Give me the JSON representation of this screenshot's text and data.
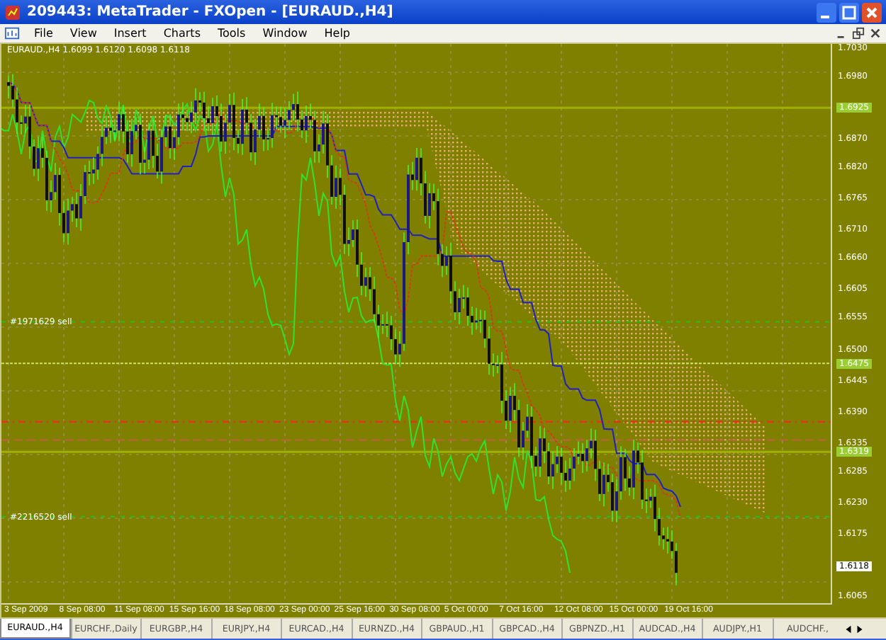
{
  "window": {
    "title": "209443: MetaTrader - FXOpen - [EURAUD.,H4]"
  },
  "menu": [
    "File",
    "View",
    "Insert",
    "Charts",
    "Tools",
    "Window",
    "Help"
  ],
  "chart": {
    "header": "EURAUD.,H4  1.6099 1.6120 1.6098 1.6118",
    "order_labels": [
      "#1971629 sell",
      "#2216520 sell"
    ],
    "price_axis": {
      "ticks": [
        "1.7030",
        "1.6980",
        "1.6870",
        "1.6820",
        "1.6765",
        "1.6710",
        "1.6660",
        "1.6605",
        "1.6555",
        "1.6500",
        "1.6445",
        "1.6390",
        "1.6335",
        "1.6285",
        "1.6230",
        "1.6175",
        "1.6065"
      ],
      "markers": [
        {
          "text": "1.6925",
          "kind": "level"
        },
        {
          "text": "1.6475",
          "kind": "level"
        },
        {
          "text": "1.6319",
          "kind": "level"
        },
        {
          "text": "1.6118",
          "kind": "bid"
        }
      ]
    },
    "time_axis": [
      "3 Sep 2009",
      "8 Sep 08:00",
      "11 Sep 08:00",
      "15 Sep 16:00",
      "18 Sep 08:00",
      "23 Sep 00:00",
      "25 Sep 16:00",
      "30 Sep 08:00",
      "5 Oct 00:00",
      "7 Oct 16:00",
      "12 Oct 08:00",
      "15 Oct 00:00",
      "19 Oct 16:00"
    ]
  },
  "tabs": [
    {
      "label": "EURAUD.,H4",
      "selected": true
    },
    {
      "label": "EURCHF.,Daily",
      "selected": false
    },
    {
      "label": "EURGBP.,H4",
      "selected": false
    },
    {
      "label": "EURJPY.,H4",
      "selected": false
    },
    {
      "label": "EURCAD.,H4",
      "selected": false
    },
    {
      "label": "EURNZD.,H4",
      "selected": false
    },
    {
      "label": "GBPAUD.,H1",
      "selected": false
    },
    {
      "label": "GBPCAD.,H4",
      "selected": false
    },
    {
      "label": "GBPNZD.,H1",
      "selected": false
    },
    {
      "label": "AUDCAD.,H4",
      "selected": false
    },
    {
      "label": "AUDJPY.,H1",
      "selected": false
    },
    {
      "label": "AUDCHF.,",
      "selected": false
    }
  ]
}
